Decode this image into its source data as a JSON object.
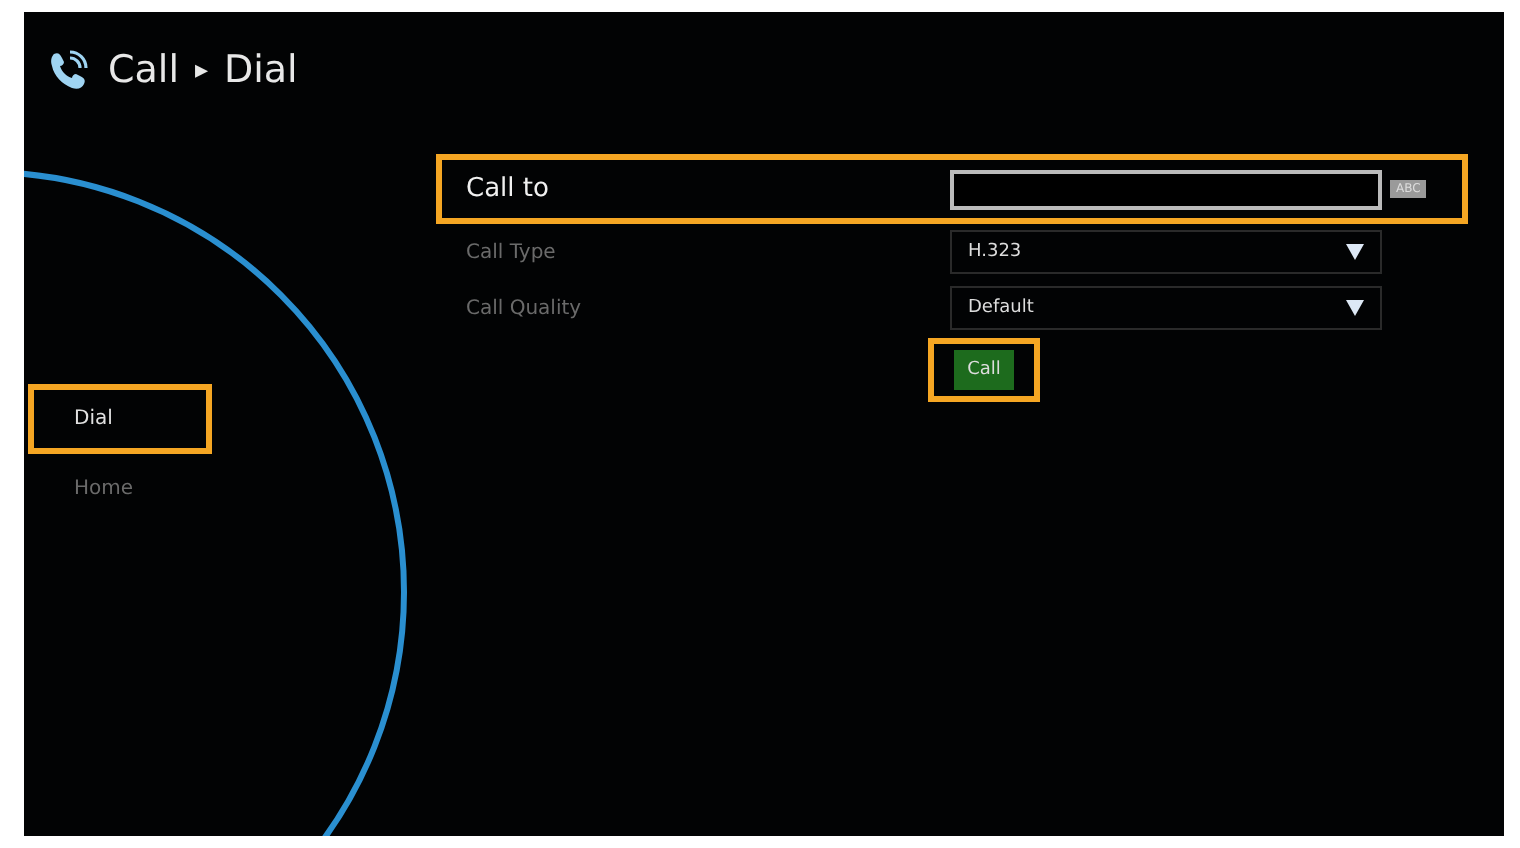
{
  "header": {
    "breadcrumb": [
      "Call",
      "Dial"
    ],
    "separator": "▸"
  },
  "sidebar": {
    "items": [
      {
        "label": "Dial",
        "selected": true,
        "highlighted": true
      },
      {
        "label": "Home",
        "selected": false,
        "highlighted": false
      }
    ]
  },
  "form": {
    "rows": [
      {
        "kind": "text",
        "label": "Call to",
        "value": "",
        "badge": "ABC",
        "focused": true,
        "highlighted": true
      },
      {
        "kind": "select",
        "label": "Call Type",
        "value": "H.323",
        "focused": false,
        "highlighted": false
      },
      {
        "kind": "select",
        "label": "Call Quality",
        "value": "Default",
        "focused": false,
        "highlighted": false
      }
    ],
    "button": {
      "label": "Call",
      "highlighted": true
    }
  }
}
